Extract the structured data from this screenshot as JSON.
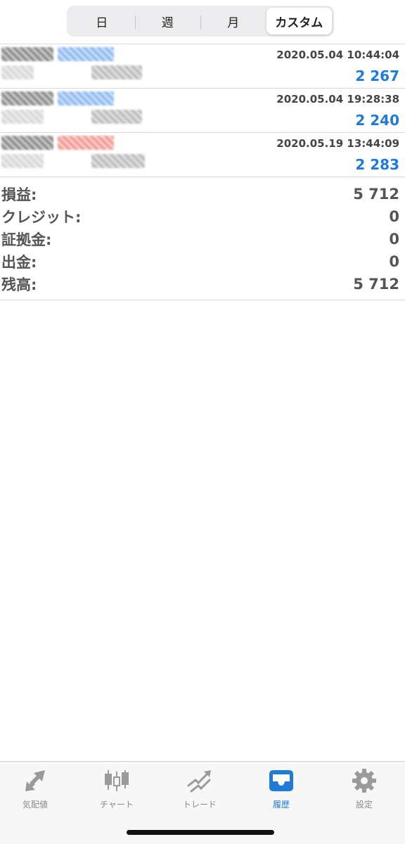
{
  "period_tabs": [
    {
      "label": "日",
      "active": false
    },
    {
      "label": "週",
      "active": false
    },
    {
      "label": "月",
      "active": false
    },
    {
      "label": "カスタム",
      "active": true
    }
  ],
  "deals": [
    {
      "time": "2020.05.04 10:44:04",
      "amount": "2 267",
      "tag_color": "blue"
    },
    {
      "time": "2020.05.04 19:28:38",
      "amount": "2 240",
      "tag_color": "blue"
    },
    {
      "time": "2020.05.19 13:44:09",
      "amount": "2 283",
      "tag_color": "red"
    }
  ],
  "summary": {
    "profit_label": "損益:",
    "profit_value": "5 712",
    "credit_label": "クレジット:",
    "credit_value": "0",
    "margin_label": "証拠金:",
    "margin_value": "0",
    "withdrawal_label": "出金:",
    "withdrawal_value": "0",
    "balance_label": "残高:",
    "balance_value": "5 712"
  },
  "tabbar": [
    {
      "label": "気配値",
      "icon": "quotes-arrows-icon",
      "active": false
    },
    {
      "label": "チャート",
      "icon": "candlestick-icon",
      "active": false
    },
    {
      "label": "トレード",
      "icon": "trade-trend-icon",
      "active": false
    },
    {
      "label": "履歴",
      "icon": "history-inbox-icon",
      "active": true
    },
    {
      "label": "設定",
      "icon": "gear-icon",
      "active": false
    }
  ],
  "colors": {
    "accent": "#1e7bd9",
    "inactive": "#8a8a8a",
    "profit": "#1e7bd9"
  }
}
